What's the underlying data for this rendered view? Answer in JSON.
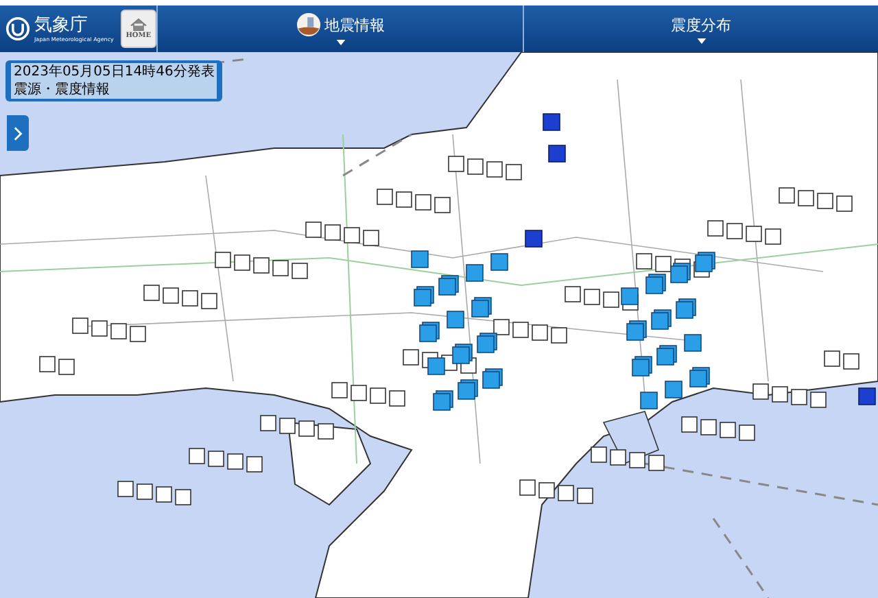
{
  "header": {
    "logo_text": "気象庁",
    "logo_subtitle": "Japan Meteorological Agency",
    "home_button": "HOME"
  },
  "nav_tabs": [
    {
      "label": "地震情報",
      "kind": "icon"
    },
    {
      "label": "震度分布",
      "kind": "plain"
    }
  ],
  "info_panel": {
    "issued": "2023年05月05日14時46分発表",
    "title": "震源・震度情報"
  }
}
